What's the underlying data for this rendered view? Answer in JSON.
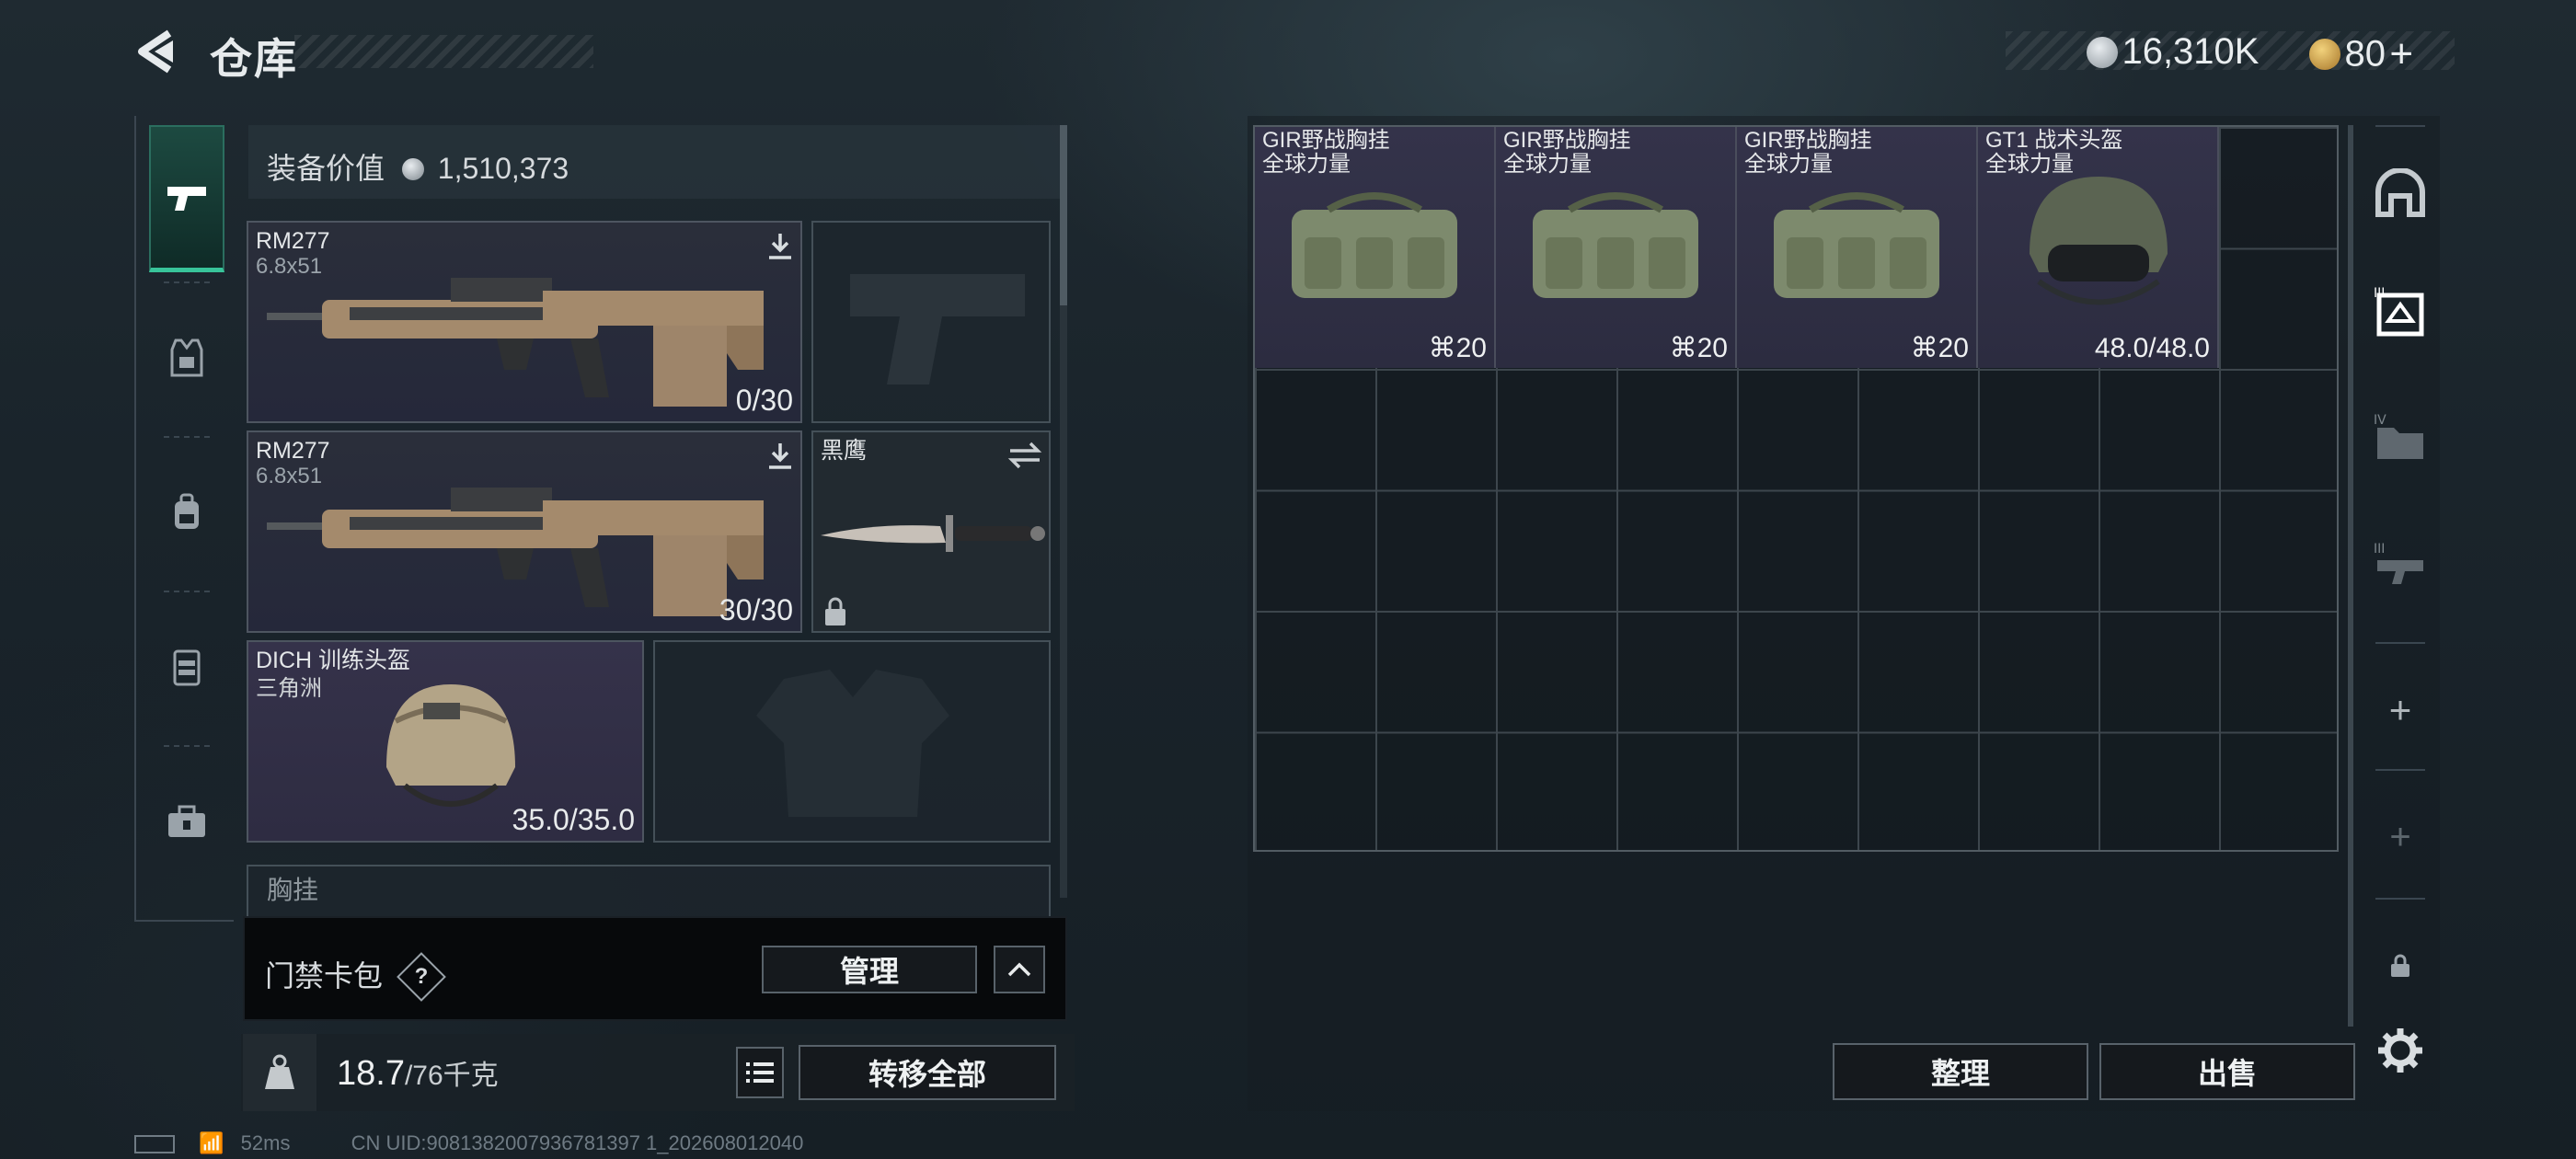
{
  "header": {
    "title": "仓库"
  },
  "currency": {
    "silver": "16,310K",
    "gold": "80"
  },
  "left": {
    "equip_value_label": "装备价值",
    "equip_value": "1,510,373",
    "slots": {
      "primary1": {
        "name": "RM277",
        "caliber": "6.8x51",
        "ammo": "0/30"
      },
      "primary2": {
        "name": "RM277",
        "caliber": "6.8x51",
        "ammo": "30/30"
      },
      "melee": {
        "name": "黑鹰"
      },
      "helmet": {
        "name": "DICH 训练头盔",
        "sub": "三角洲",
        "durability": "35.0/35.0"
      },
      "next_section": "胸挂"
    },
    "access": {
      "label": "门禁卡包",
      "help": "?",
      "manage_label": "管理"
    },
    "weight": {
      "current": "18.7",
      "max": "/76千克",
      "transfer_label": "转移全部"
    }
  },
  "right": {
    "items": [
      {
        "name": "GIR野战胸挂",
        "sub": "全球力量",
        "count": "20"
      },
      {
        "name": "GIR野战胸挂",
        "sub": "全球力量",
        "count": "20"
      },
      {
        "name": "GIR野战胸挂",
        "sub": "全球力量",
        "count": "20"
      },
      {
        "name": "GT1 战术头盔",
        "sub": "全球力量",
        "count": "48.0/48.0"
      }
    ],
    "sort_label": "整理",
    "sell_label": "出售"
  },
  "status": {
    "ping": "52ms",
    "uid": "CN UID:9081382007936781397 1_202608012040"
  },
  "colors": {
    "accent": "#38c49a",
    "item_bg": "#2f2e44"
  }
}
